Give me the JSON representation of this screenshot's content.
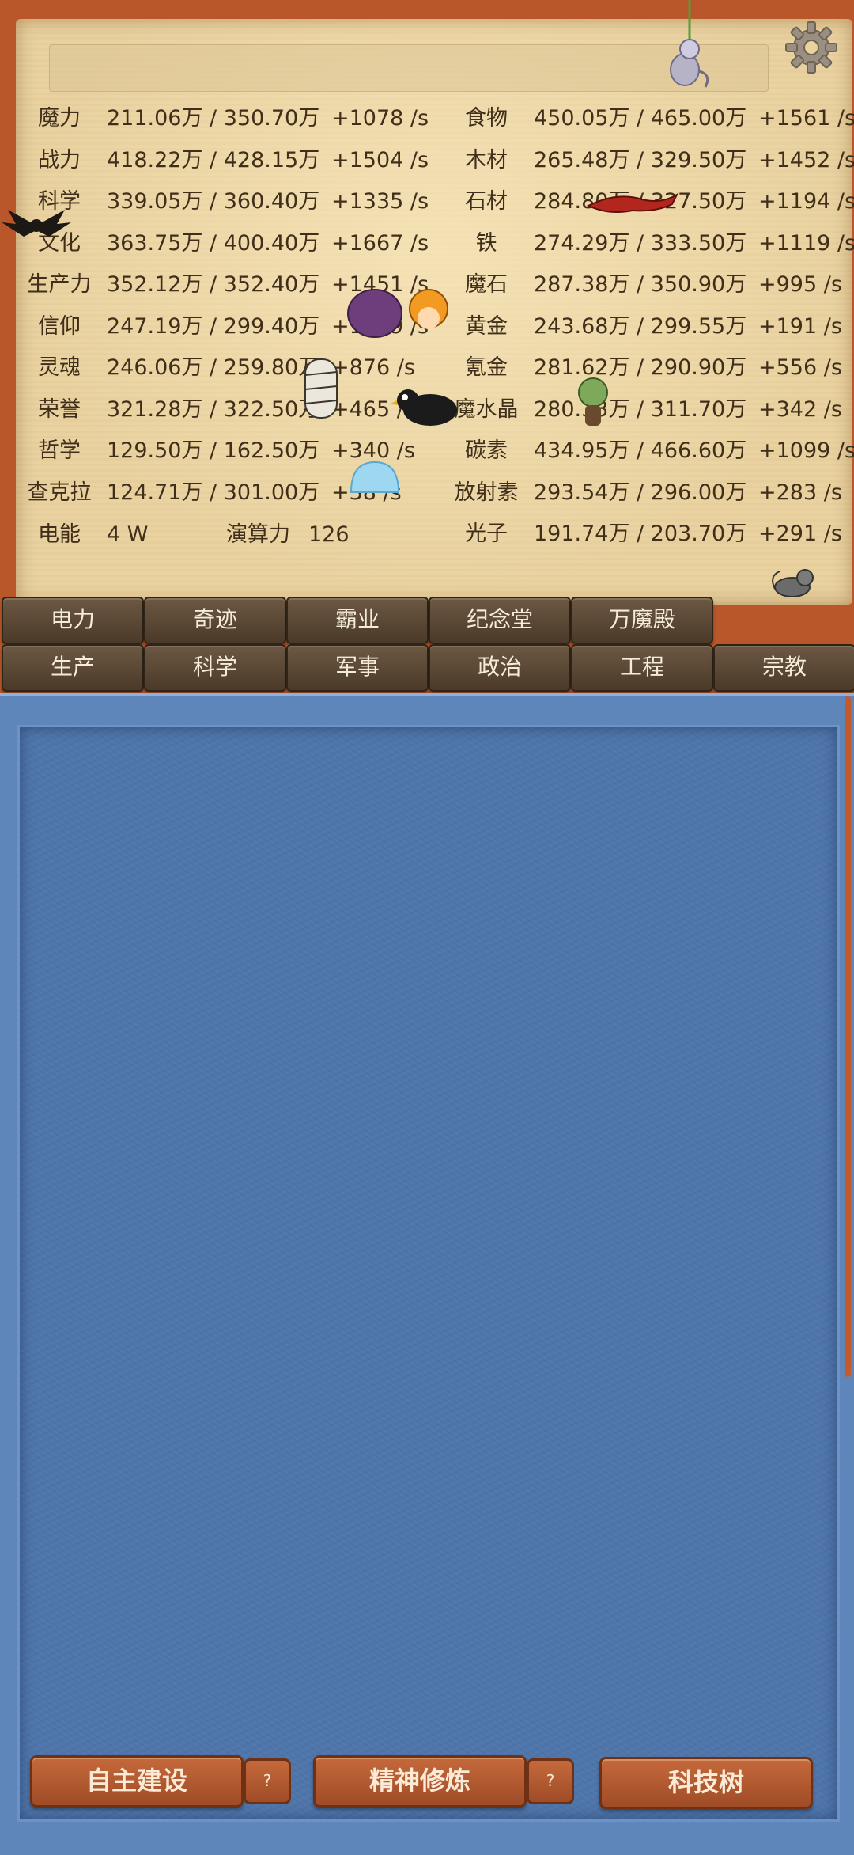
{
  "resources_left": [
    {
      "name": "魔力",
      "amount": "211.06万 / 350.70万",
      "rate": "+1078 /s"
    },
    {
      "name": "战力",
      "amount": "418.22万 / 428.15万",
      "rate": "+1504 /s"
    },
    {
      "name": "科学",
      "amount": "339.05万 / 360.40万",
      "rate": "+1335 /s"
    },
    {
      "name": "文化",
      "amount": "363.75万 / 400.40万",
      "rate": "+1667 /s"
    },
    {
      "name": "生产力",
      "amount": "352.12万 / 352.40万",
      "rate": "+1451 /s"
    },
    {
      "name": "信仰",
      "amount": "247.19万 / 299.40万",
      "rate": "+1229 /s"
    },
    {
      "name": "灵魂",
      "amount": "246.06万 / 259.80万",
      "rate": "+876 /s"
    },
    {
      "name": "荣誉",
      "amount": "321.28万 / 322.50万",
      "rate": "+465 /s"
    },
    {
      "name": "哲学",
      "amount": "129.50万 / 162.50万",
      "rate": "+340 /s"
    },
    {
      "name": "查克拉",
      "amount": "124.71万 / 301.00万",
      "rate": "+38 /s"
    }
  ],
  "resources_right": [
    {
      "name": "食物",
      "amount": "450.05万 / 465.00万",
      "rate": "+1561 /s"
    },
    {
      "name": "木材",
      "amount": "265.48万 / 329.50万",
      "rate": "+1452 /s"
    },
    {
      "name": "石材",
      "amount": "284.80万 / 327.50万",
      "rate": "+1194 /s"
    },
    {
      "name": "铁",
      "amount": "274.29万 / 333.50万",
      "rate": "+1119 /s"
    },
    {
      "name": "魔石",
      "amount": "287.38万 / 350.90万",
      "rate": "+995 /s"
    },
    {
      "name": "黄金",
      "amount": "243.68万 / 299.55万",
      "rate": "+191 /s"
    },
    {
      "name": "氪金",
      "amount": "281.62万 / 290.90万",
      "rate": "+556 /s"
    },
    {
      "name": "魔水晶",
      "amount": "280.33万 / 311.70万",
      "rate": "+342 /s"
    },
    {
      "name": "碳素",
      "amount": "434.95万 / 466.60万",
      "rate": "+1099 /s"
    },
    {
      "name": "放射素",
      "amount": "293.54万 / 296.00万",
      "rate": "+283 /s"
    },
    {
      "name": "光子",
      "amount": "191.74万 / 203.70万",
      "rate": "+291 /s"
    }
  ],
  "power": {
    "label": "电能",
    "value": "4 W"
  },
  "compute": {
    "label": "演算力",
    "value": "126"
  },
  "tabs_row1": [
    "电力",
    "奇迹",
    "霸业",
    "纪念堂",
    "万魔殿"
  ],
  "tabs_row2": [
    "生产",
    "科学",
    "军事",
    "政治",
    "工程",
    "宗教"
  ],
  "bottom": {
    "build": "自主建设",
    "build_help": "?",
    "train": "精神修炼",
    "train_help": "?",
    "tech": "科技树"
  },
  "colors": {
    "accent": "#b9572a",
    "panel": "#4f76ab",
    "parchment": "#e9d2a0",
    "tab": "#4b3a29"
  }
}
